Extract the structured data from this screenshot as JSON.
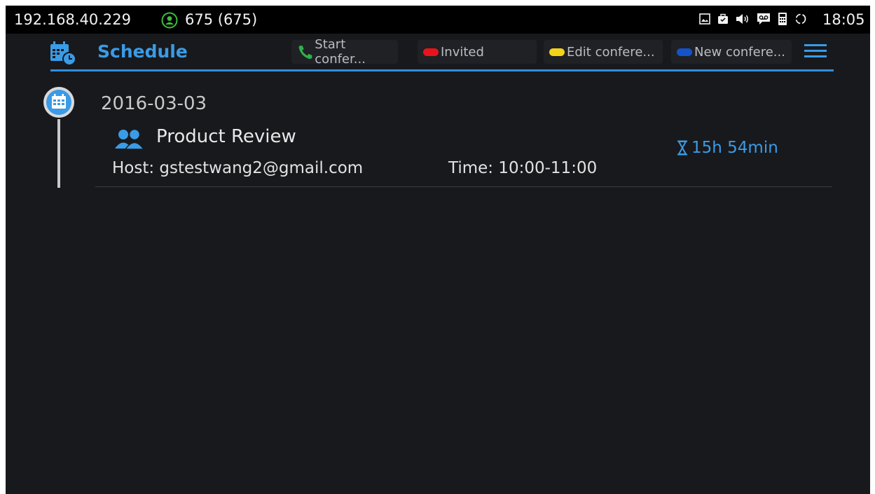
{
  "status_bar": {
    "ip_address": "192.168.40.229",
    "account": "675 (675)",
    "clock": "18:05",
    "icons": [
      "gallery-icon",
      "briefcase-icon",
      "volume-icon",
      "voicemail-icon",
      "phone-lock-icon",
      "sync-icon"
    ]
  },
  "header": {
    "title": "Schedule",
    "softkeys": {
      "start": "Start confer...",
      "invited": "Invited",
      "edit": "Edit confere...",
      "new": "New confere..."
    }
  },
  "schedule": {
    "entries": [
      {
        "date": "2016-03-03",
        "title": "Product Review",
        "host": "Host: gstestwang2@gmail.com",
        "time": "Time: 10:00-11:00",
        "remaining": "15h 54min"
      }
    ]
  },
  "colors": {
    "accent": "#3a9be6",
    "background": "#18191d",
    "status_bar": "#000000",
    "start_green": "#2db24a",
    "invited_red": "#e8141c",
    "edit_yellow": "#f3d21a",
    "new_blue": "#1554c8"
  }
}
